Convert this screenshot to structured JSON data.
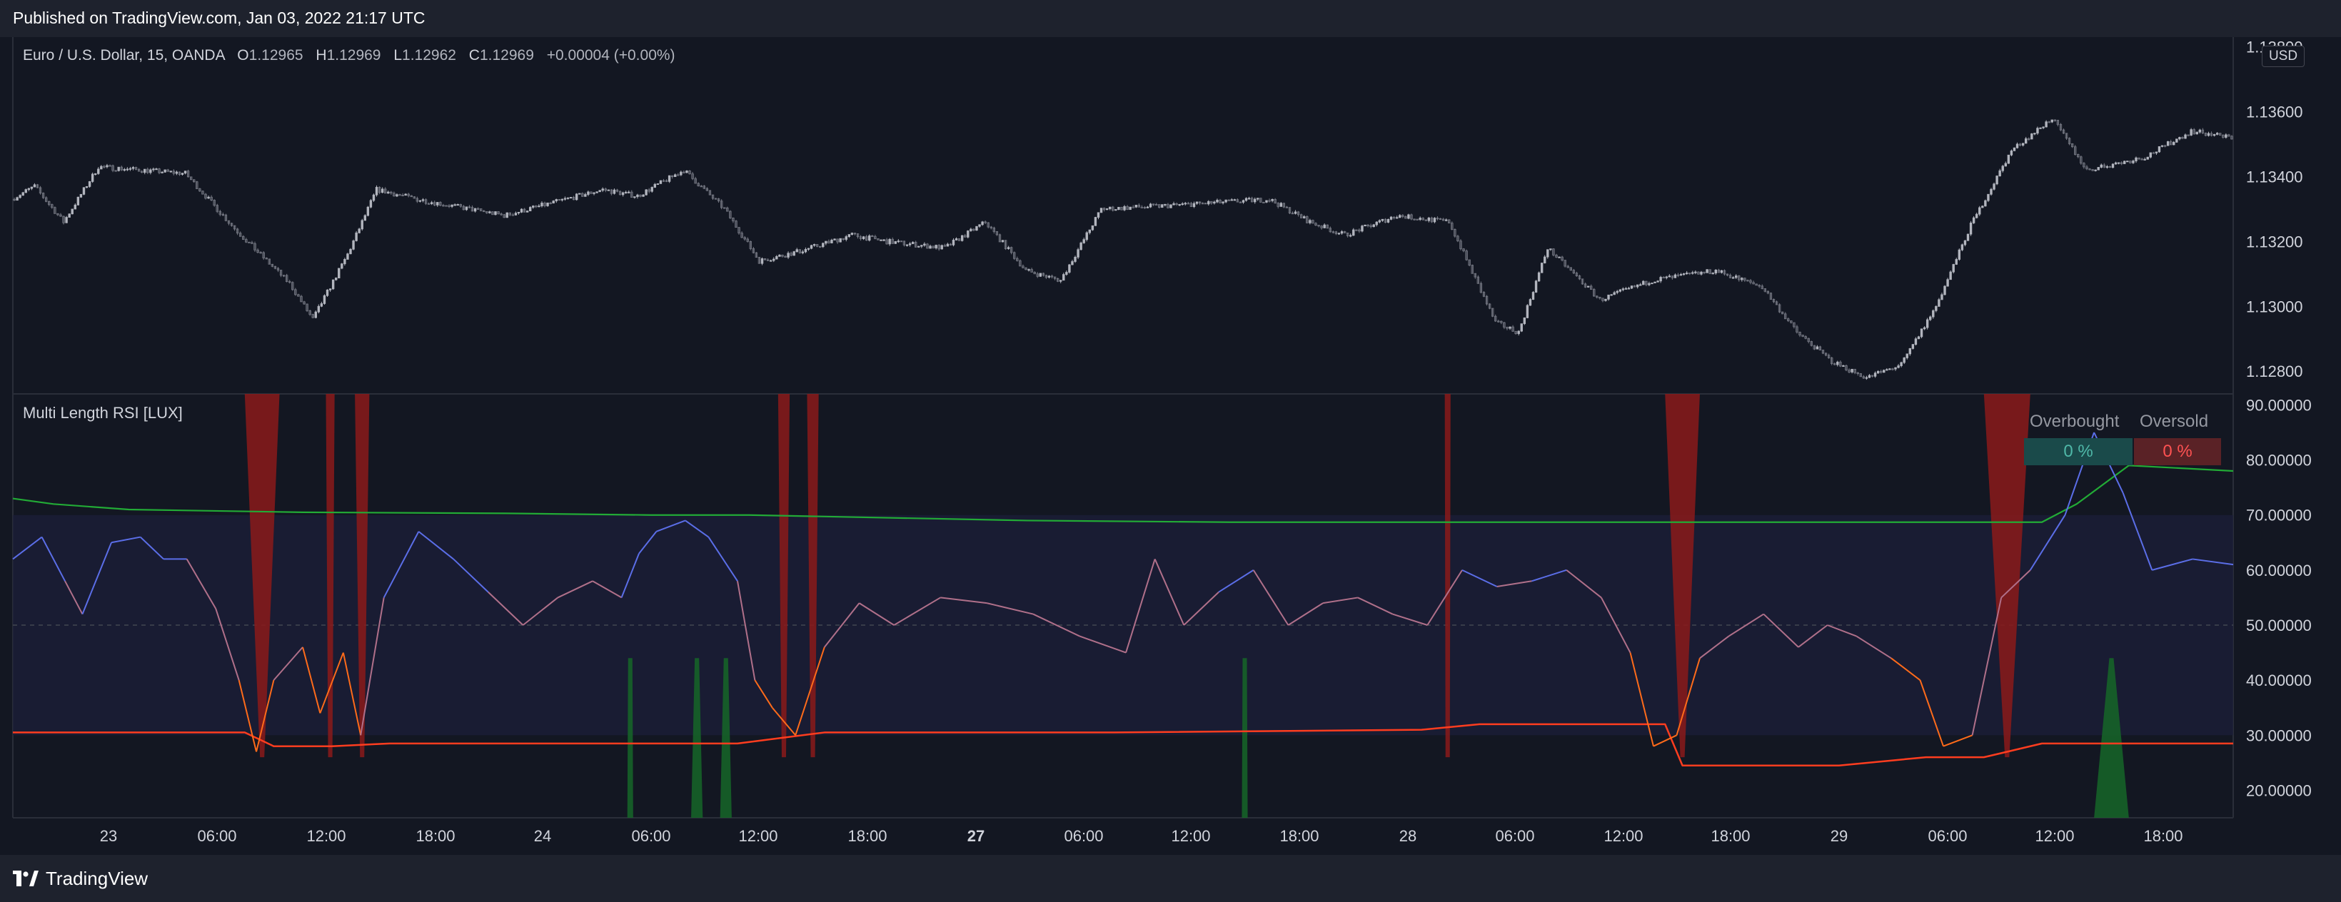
{
  "header": {
    "published": "Published on TradingView.com, Jan 03, 2022 21:17 UTC"
  },
  "footer": {
    "brand": "TradingView"
  },
  "legend": {
    "symbol": "Euro / U.S. Dollar, 15, OANDA",
    "o_label": "O",
    "o": "1.12965",
    "h_label": "H",
    "h": "1.12969",
    "l_label": "L",
    "l": "1.12962",
    "c_label": "C",
    "c": "1.12969",
    "change": "+0.00004 (+0.00%)"
  },
  "price_axis": {
    "currency": "USD",
    "ticks": [
      "1.13800",
      "1.13600",
      "1.13400",
      "1.13200",
      "1.13000",
      "1.12800"
    ]
  },
  "indicator": {
    "title": "Multi Length RSI [LUX]",
    "axis_ticks": [
      "90.00000",
      "80.00000",
      "70.00000",
      "60.00000",
      "50.00000",
      "40.00000",
      "30.00000",
      "20.00000"
    ],
    "table": {
      "overbought_label": "Overbought",
      "oversold_label": "Oversold",
      "overbought_value": "0 %",
      "oversold_value": "0 %"
    }
  },
  "time_axis": [
    "23",
    "06:00",
    "12:00",
    "18:00",
    "24",
    "06:00",
    "12:00",
    "18:00",
    "27",
    "06:00",
    "12:00",
    "18:00",
    "28",
    "06:00",
    "12:00",
    "18:00",
    "29",
    "06:00",
    "12:00",
    "18:00"
  ],
  "colors": {
    "background": "#131722",
    "bull": "#b2b5be",
    "bear": "#787b86",
    "upper": "#22ab36",
    "lower": "#ff3d1f",
    "rsi_high": "#5b6ee8",
    "rsi_low": "#ff6b1a",
    "ob_zone": "#8b1a1a",
    "os_zone": "#166628",
    "ob_cell": "#1a4a4a",
    "os_cell": "#5a2226",
    "ob_text": "#4fb8a8",
    "os_text": "#ff5252"
  },
  "chart_data": [
    {
      "type": "candlestick",
      "title": "",
      "ylabel": "USD",
      "ylim": [
        1.1273,
        1.1383
      ],
      "x": [
        "Dec 23",
        "Dec 24",
        "Dec 27",
        "Dec 28",
        "Dec 29"
      ],
      "close_path": [
        [
          0,
          1.1333
        ],
        [
          8,
          1.1337
        ],
        [
          18,
          1.1326
        ],
        [
          30,
          1.1343
        ],
        [
          60,
          1.1341
        ],
        [
          78,
          1.1323
        ],
        [
          96,
          1.1307
        ],
        [
          104,
          1.1296
        ],
        [
          116,
          1.1316
        ],
        [
          126,
          1.1336
        ],
        [
          140,
          1.1333
        ],
        [
          170,
          1.1328
        ],
        [
          204,
          1.1336
        ],
        [
          216,
          1.1334
        ],
        [
          232,
          1.1342
        ],
        [
          246,
          1.133
        ],
        [
          258,
          1.1314
        ],
        [
          272,
          1.1317
        ],
        [
          290,
          1.1322
        ],
        [
          302,
          1.132
        ],
        [
          322,
          1.1318
        ],
        [
          336,
          1.1326
        ],
        [
          350,
          1.1311
        ],
        [
          362,
          1.1308
        ],
        [
          376,
          1.133
        ],
        [
          398,
          1.1331
        ],
        [
          416,
          1.1332
        ],
        [
          434,
          1.1333
        ],
        [
          448,
          1.1326
        ],
        [
          460,
          1.1322
        ],
        [
          478,
          1.1328
        ],
        [
          496,
          1.1326
        ],
        [
          512,
          1.1295
        ],
        [
          520,
          1.1292
        ],
        [
          530,
          1.1318
        ],
        [
          548,
          1.1302
        ],
        [
          566,
          1.1308
        ],
        [
          588,
          1.1311
        ],
        [
          604,
          1.1306
        ],
        [
          616,
          1.1292
        ],
        [
          628,
          1.1283
        ],
        [
          640,
          1.1278
        ],
        [
          652,
          1.1282
        ],
        [
          664,
          1.13
        ],
        [
          676,
          1.1325
        ],
        [
          690,
          1.1348
        ],
        [
          704,
          1.1358
        ],
        [
          716,
          1.1342
        ],
        [
          736,
          1.1346
        ],
        [
          752,
          1.1354
        ],
        [
          766,
          1.1352
        ]
      ]
    },
    {
      "type": "line",
      "title": "Multi Length RSI [LUX]",
      "ylim": [
        15,
        92
      ],
      "series": [
        {
          "name": "",
          "values": [
            [
              0,
              62
            ],
            [
              10,
              66
            ],
            [
              18,
              58
            ],
            [
              24,
              52
            ],
            [
              34,
              65
            ],
            [
              44,
              66
            ],
            [
              52,
              62
            ],
            [
              60,
              62
            ],
            [
              70,
              53
            ],
            [
              78,
              40
            ],
            [
              84,
              27
            ],
            [
              90,
              40
            ],
            [
              100,
              46
            ],
            [
              106,
              34
            ],
            [
              114,
              45
            ],
            [
              120,
              30
            ],
            [
              128,
              55
            ],
            [
              140,
              67
            ],
            [
              152,
              62
            ],
            [
              164,
              56
            ],
            [
              176,
              50
            ],
            [
              188,
              55
            ],
            [
              200,
              58
            ],
            [
              210,
              55
            ],
            [
              216,
              63
            ],
            [
              222,
              67
            ],
            [
              232,
              69
            ],
            [
              240,
              66
            ],
            [
              250,
              58
            ],
            [
              256,
              40
            ],
            [
              262,
              35
            ],
            [
              270,
              30
            ],
            [
              280,
              46
            ],
            [
              292,
              54
            ],
            [
              304,
              50
            ],
            [
              320,
              55
            ],
            [
              336,
              54
            ],
            [
              352,
              52
            ],
            [
              368,
              48
            ],
            [
              384,
              45
            ],
            [
              394,
              62
            ],
            [
              404,
              50
            ],
            [
              416,
              56
            ],
            [
              428,
              60
            ],
            [
              440,
              50
            ],
            [
              452,
              54
            ],
            [
              464,
              55
            ],
            [
              476,
              52
            ],
            [
              488,
              50
            ],
            [
              500,
              60
            ],
            [
              512,
              57
            ],
            [
              524,
              58
            ],
            [
              536,
              60
            ],
            [
              548,
              55
            ],
            [
              558,
              45
            ],
            [
              566,
              28
            ],
            [
              574,
              30
            ],
            [
              582,
              44
            ],
            [
              592,
              48
            ],
            [
              604,
              52
            ],
            [
              616,
              46
            ],
            [
              626,
              50
            ],
            [
              636,
              48
            ],
            [
              648,
              44
            ],
            [
              658,
              40
            ],
            [
              666,
              28
            ],
            [
              676,
              30
            ],
            [
              686,
              55
            ],
            [
              696,
              60
            ],
            [
              708,
              70
            ],
            [
              718,
              85
            ],
            [
              728,
              74
            ],
            [
              738,
              60
            ],
            [
              752,
              62
            ],
            [
              766,
              61
            ]
          ]
        },
        {
          "name": "",
          "values": [
            [
              0,
              73
            ],
            [
              14,
              72
            ],
            [
              40,
              71
            ],
            [
              100,
              70.5
            ],
            [
              170,
              70.3
            ],
            [
              220,
              70
            ],
            [
              254,
              70
            ],
            [
              350,
              69
            ],
            [
              420,
              68.7
            ],
            [
              530,
              68.7
            ],
            [
              700,
              68.7
            ],
            [
              712,
              72
            ],
            [
              730,
              79
            ],
            [
              766,
              78
            ]
          ]
        },
        {
          "name": "",
          "values": [
            [
              0,
              30.5
            ],
            [
              80,
              30.5
            ],
            [
              90,
              28
            ],
            [
              110,
              28
            ],
            [
              130,
              28.5
            ],
            [
              250,
              28.5
            ],
            [
              280,
              30.5
            ],
            [
              380,
              30.5
            ],
            [
              486,
              31
            ],
            [
              506,
              32
            ],
            [
              570,
              32
            ],
            [
              576,
              24.5
            ],
            [
              630,
              24.5
            ],
            [
              660,
              26
            ],
            [
              680,
              26
            ],
            [
              700,
              28.5
            ],
            [
              766,
              28.5
            ]
          ]
        }
      ],
      "overbought_zones": [
        [
          80,
          92
        ],
        [
          108,
          111
        ],
        [
          118,
          123
        ],
        [
          264,
          268
        ],
        [
          274,
          278
        ],
        [
          494,
          496
        ],
        [
          570,
          582
        ],
        [
          680,
          696
        ]
      ],
      "oversold_zones": [
        [
          212,
          214
        ],
        [
          234,
          238
        ],
        [
          244,
          248
        ],
        [
          424,
          426
        ],
        [
          718,
          730
        ]
      ]
    }
  ]
}
